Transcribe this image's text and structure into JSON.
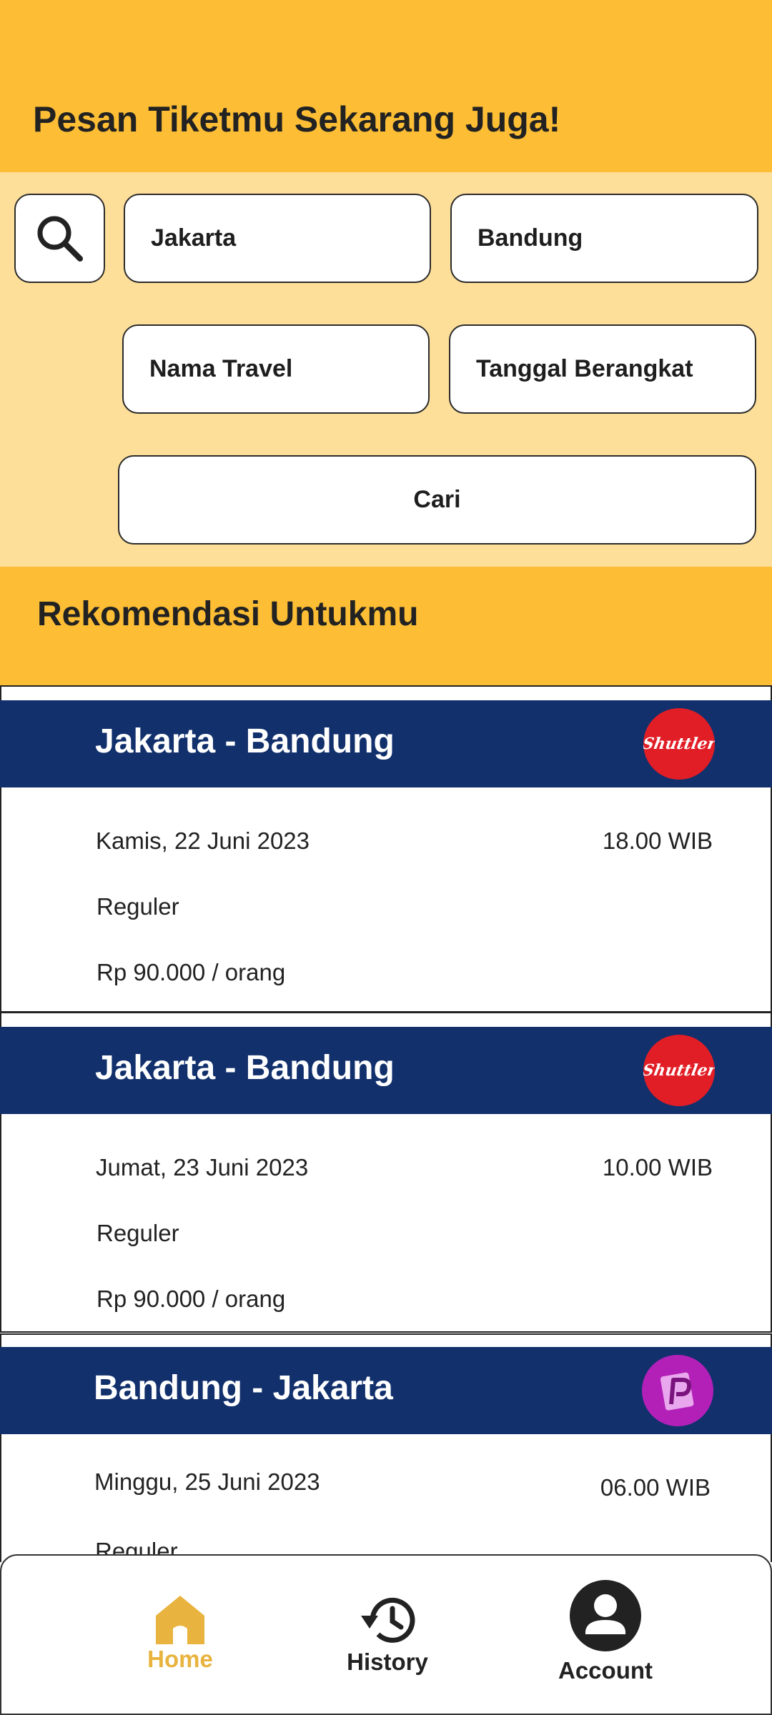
{
  "header": {
    "title": "Pesan Tiketmu Sekarang Juga!"
  },
  "search": {
    "from": "Jakarta",
    "to": "Bandung",
    "travel_name": "Nama Travel",
    "departure_date": "Tanggal Berangkat",
    "submit_label": "Cari"
  },
  "recommendations": {
    "title": "Rekomendasi Untukmu",
    "cards": [
      {
        "route": "Jakarta - Bandung",
        "date": "Kamis, 22 Juni 2023",
        "time": "18.00 WIB",
        "class": "Reguler",
        "price": "Rp 90.000 / orang",
        "logo": "shuttle-logo",
        "logo_text": "Shuttler"
      },
      {
        "route": "Jakarta - Bandung",
        "date": "Jumat, 23 Juni 2023",
        "time": "10.00 WIB",
        "class": "Reguler",
        "price": "Rp 90.000 / orang",
        "logo": "shuttle-logo",
        "logo_text": "Shuttler"
      },
      {
        "route": "Bandung - Jakarta",
        "date": "Minggu, 25 Juni 2023",
        "time": "06.00 WIB",
        "class": "Reguler",
        "logo": "p-logo"
      }
    ]
  },
  "nav": {
    "items": [
      {
        "label": "Home",
        "icon": "home-icon",
        "active": true
      },
      {
        "label": "History",
        "icon": "history-icon",
        "active": false
      },
      {
        "label": "Account",
        "icon": "account-icon",
        "active": false
      }
    ]
  },
  "colors": {
    "header_bg": "#FDBE35",
    "panel_bg": "#FDDF9A",
    "card_header": "#12306C",
    "active_nav": "#E8B33E"
  }
}
